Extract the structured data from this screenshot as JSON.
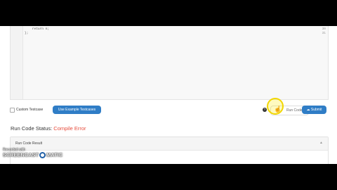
{
  "editor": {
    "lines": [
      {
        "num": "30",
        "text": "    return n;"
      },
      {
        "num": "31",
        "text": "};"
      }
    ]
  },
  "controls": {
    "custom_testcase_label": "Custom Testcase",
    "example_button_label": "Use Example Testcases",
    "help_icon_glyph": "?",
    "run_button_label": "Run Code",
    "submit_button_label": "Submit",
    "submit_icon": "cloud-upload-icon"
  },
  "status": {
    "label": "Run Code Status:",
    "value": "Compile Error",
    "value_color": "#e74c3c"
  },
  "result": {
    "title": "Run Code Result",
    "collapse_glyph": "▲"
  },
  "watermark": {
    "line1": "Recorded with",
    "brand_left": "SCREENCAST",
    "brand_right": "MATIC"
  },
  "accent_color": "#2f7dc6"
}
